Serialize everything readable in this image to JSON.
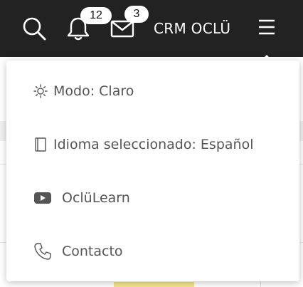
{
  "topbar": {
    "brand": "CRM OCLÜ",
    "notifications_count": "12",
    "messages_count": "3",
    "icons": [
      "search-icon",
      "bell-icon",
      "mail-icon",
      "hamburger-icon"
    ]
  },
  "menu": {
    "items": [
      {
        "label": "Modo: Claro",
        "icon": "sun-icon"
      },
      {
        "label": "Idioma seleccionado: Español",
        "icon": "book-icon"
      },
      {
        "label": "OclüLearn",
        "icon": "youtube-icon"
      },
      {
        "label": "Contacto",
        "icon": "phone-icon"
      }
    ]
  },
  "colors": {
    "topbar_bg": "#222222",
    "menu_text": "#555555",
    "badge_bg": "#ffffff"
  }
}
